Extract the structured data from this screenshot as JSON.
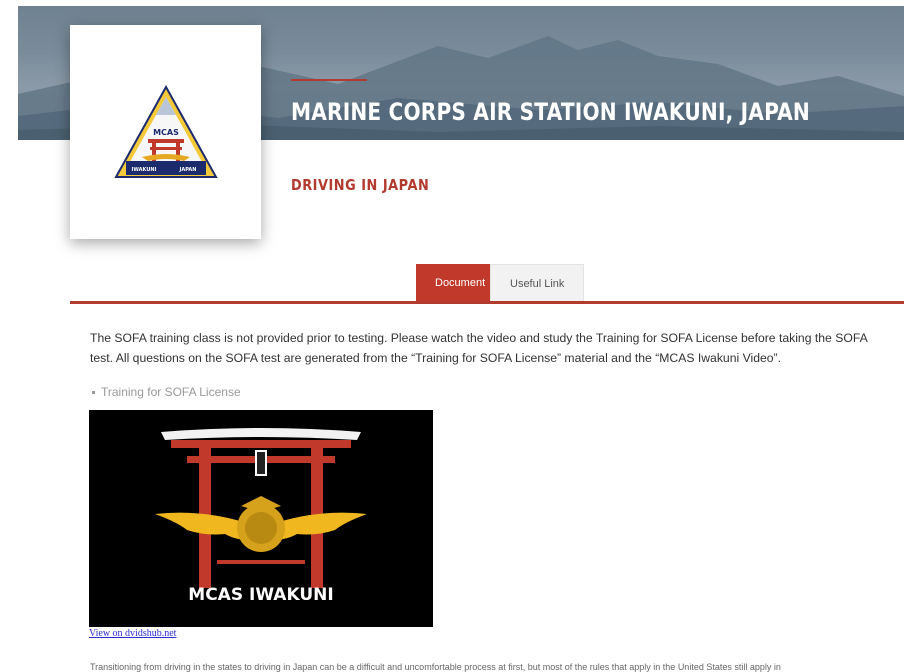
{
  "header": {
    "site_title": "MARINE CORPS AIR STATION IWAKUNI, JAPAN",
    "page_subtitle": "DRIVING IN JAPAN",
    "logo": {
      "top_text": "MCAS",
      "bottom_left": "IWAKUNI",
      "bottom_right": "JAPAN"
    }
  },
  "tabs": [
    {
      "label": "Document",
      "active": true
    },
    {
      "label": "Useful Link",
      "active": false
    }
  ],
  "content": {
    "intro": "The SOFA training class is not provided prior to testing. Please watch the video and study the Training for SOFA License before taking the SOFA test. All questions on the SOFA test are generated from the “Training for SOFA License” material and the “MCAS Iwakuni Video”.",
    "bullet_link": "Training for SOFA License",
    "video_caption": "MCAS IWAKUNI",
    "video_link": "View on dvidshub.net",
    "cut_paragraph": "Transitioning from driving in the states to driving in Japan can be a difficult and uncomfortable process at first, but most of the rules that apply in the United States still apply in"
  },
  "colors": {
    "accent_red": "#b23a2e",
    "tab_active": "#c0392b",
    "link_blue": "#2b2bd6"
  }
}
